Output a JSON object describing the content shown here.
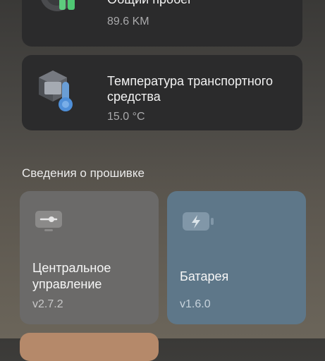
{
  "vehicle_info": {
    "mileage": {
      "title": "Общий пробег",
      "value": "89.6 KM",
      "icon": "odometer-icon"
    },
    "temperature": {
      "title": "Температура транспортного средства",
      "value": "15.0 °C",
      "icon": "vehicle-temperature-icon"
    }
  },
  "firmware": {
    "heading": "Сведения о прошивке",
    "items": [
      {
        "name": "Центральное управление",
        "version": "v2.7.2",
        "icon": "central-control-icon",
        "color": "#6b6a69"
      },
      {
        "name": "Батарея",
        "version": "v1.6.0",
        "icon": "battery-icon",
        "color": "#5e7789"
      }
    ],
    "next_card_color": "#b5896a"
  }
}
